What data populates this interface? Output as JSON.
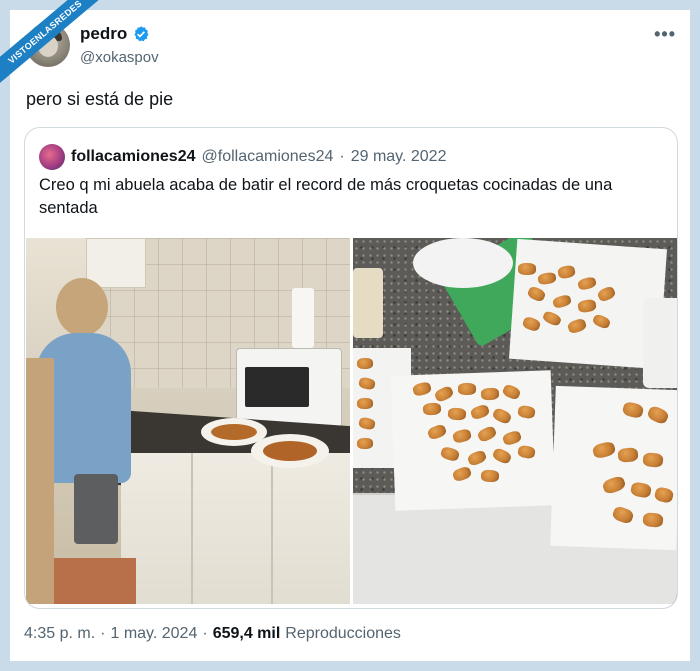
{
  "watermark": "VISTOENLASREDES",
  "author": {
    "name": "pedro",
    "handle": "@xokaspov",
    "verified_color": "#1d9bf0"
  },
  "menu_icon": "more-horizontal-icon",
  "tweet_text": "pero si está de pie",
  "quoted": {
    "name": "follacamiones24",
    "handle": "@follacamiones24",
    "separator": "·",
    "date": "29 may. 2022",
    "text": "Creo q mi abuela acaba de batir el record de más croquetas cocinadas de una sentada"
  },
  "footer": {
    "time": "4:35 p. m.",
    "separator1": "·",
    "date": "1 may. 2024",
    "separator2": "·",
    "views_count": "659,4 mil",
    "views_label": "Reproducciones"
  },
  "colors": {
    "frame": "#c9dbe9",
    "text_primary": "#0f1419",
    "text_secondary": "#536471",
    "border": "#cfd9de",
    "watermark_bg": "#1d7fc4"
  }
}
